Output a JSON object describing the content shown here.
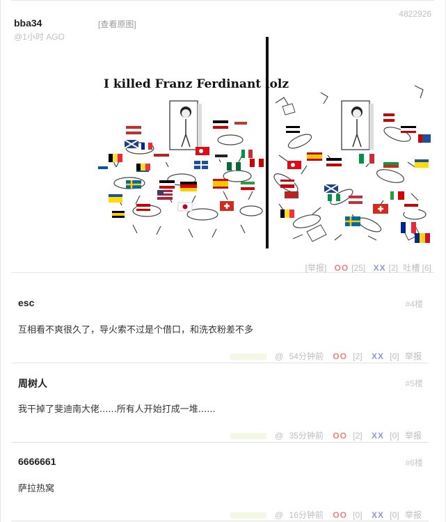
{
  "post": {
    "id": "4822926",
    "author": "bba34",
    "time": "@1小时 AGO",
    "view_original": "[查看原图]",
    "image": {
      "caption": "I killed Franz Ferdinant lolz",
      "description_icon": "comic-image"
    },
    "actions": {
      "report": "[举报]",
      "oo_label": "OO",
      "oo_count": "[25]",
      "xx_label": "XX",
      "xx_count": "[2]",
      "tucao": "吐槽 [6]"
    }
  },
  "comments": [
    {
      "author": "esc",
      "floor": "#4楼",
      "text": "互相看不爽很久了，导火索不过是个借口，和洗衣粉差不多",
      "at": "@",
      "time": "54分钟前",
      "oo_label": "OO",
      "oo_count": "[2]",
      "xx_label": "XX",
      "xx_count": "[0]",
      "report": "举报"
    },
    {
      "author": "周树人",
      "floor": "#5楼",
      "text": "我干掉了斐迪南大佬......所有人开始打成一堆......",
      "at": "@",
      "time": "35分钟前",
      "oo_label": "OO",
      "oo_count": "[2]",
      "xx_label": "XX",
      "xx_count": "[0]",
      "report": "举报"
    },
    {
      "author": "6666661",
      "floor": "#6楼",
      "text": "萨拉热窝",
      "at": "@",
      "time": "16分钟前",
      "oo_label": "OO",
      "oo_count": "[0]",
      "xx_label": "XX",
      "xx_count": "[0]",
      "report": "举报"
    }
  ]
}
